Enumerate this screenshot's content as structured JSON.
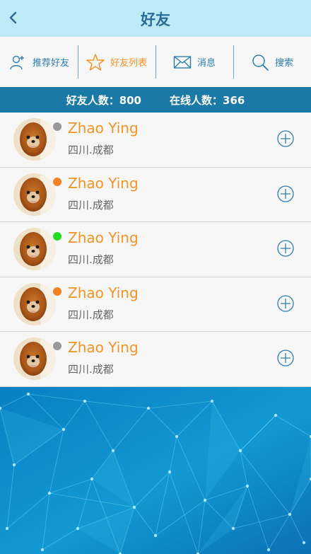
{
  "header": {
    "title": "好友",
    "back_icon": "chevron-left-icon"
  },
  "tabs": [
    {
      "label": "推荐好友",
      "icon": "add-user-icon",
      "active": false
    },
    {
      "label": "好友列表",
      "icon": "star-icon",
      "active": true
    },
    {
      "label": "消息",
      "icon": "envelope-icon",
      "active": false
    },
    {
      "label": "搜索",
      "icon": "search-icon",
      "active": false
    }
  ],
  "stats": {
    "friends": "好友人数：800",
    "online": "在线人数：366"
  },
  "friends": [
    {
      "name": "Zhao Ying",
      "location": "四川.成都",
      "status_color": "#999999"
    },
    {
      "name": "Zhao Ying",
      "location": "四川.成都",
      "status_color": "#f58220"
    },
    {
      "name": "Zhao Ying",
      "location": "四川.成都",
      "status_color": "#22dd22"
    },
    {
      "name": "Zhao Ying",
      "location": "四川.成都",
      "status_color": "#f58220"
    },
    {
      "name": "Zhao Ying",
      "location": "四川.成都",
      "status_color": "#999999"
    }
  ],
  "colors": {
    "accent": "#f39325",
    "header_bg": "#bdeaf7",
    "stats_bg": "#1b79a8",
    "link": "#2c7fb3"
  }
}
